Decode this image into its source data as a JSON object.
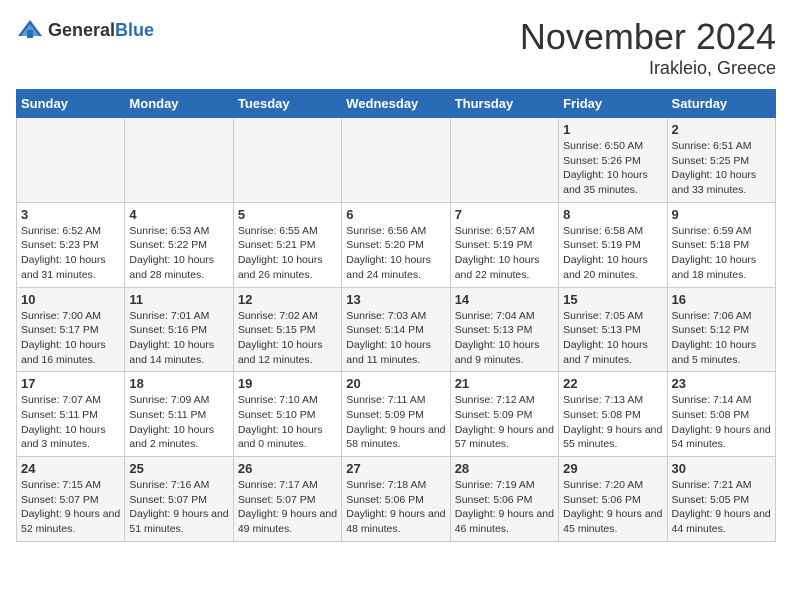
{
  "header": {
    "logo_general": "General",
    "logo_blue": "Blue",
    "month": "November 2024",
    "location": "Irakleio, Greece"
  },
  "calendar": {
    "days_of_week": [
      "Sunday",
      "Monday",
      "Tuesday",
      "Wednesday",
      "Thursday",
      "Friday",
      "Saturday"
    ],
    "weeks": [
      [
        {
          "day": "",
          "info": ""
        },
        {
          "day": "",
          "info": ""
        },
        {
          "day": "",
          "info": ""
        },
        {
          "day": "",
          "info": ""
        },
        {
          "day": "",
          "info": ""
        },
        {
          "day": "1",
          "info": "Sunrise: 6:50 AM\nSunset: 5:26 PM\nDaylight: 10 hours and 35 minutes."
        },
        {
          "day": "2",
          "info": "Sunrise: 6:51 AM\nSunset: 5:25 PM\nDaylight: 10 hours and 33 minutes."
        }
      ],
      [
        {
          "day": "3",
          "info": "Sunrise: 6:52 AM\nSunset: 5:23 PM\nDaylight: 10 hours and 31 minutes."
        },
        {
          "day": "4",
          "info": "Sunrise: 6:53 AM\nSunset: 5:22 PM\nDaylight: 10 hours and 28 minutes."
        },
        {
          "day": "5",
          "info": "Sunrise: 6:55 AM\nSunset: 5:21 PM\nDaylight: 10 hours and 26 minutes."
        },
        {
          "day": "6",
          "info": "Sunrise: 6:56 AM\nSunset: 5:20 PM\nDaylight: 10 hours and 24 minutes."
        },
        {
          "day": "7",
          "info": "Sunrise: 6:57 AM\nSunset: 5:19 PM\nDaylight: 10 hours and 22 minutes."
        },
        {
          "day": "8",
          "info": "Sunrise: 6:58 AM\nSunset: 5:19 PM\nDaylight: 10 hours and 20 minutes."
        },
        {
          "day": "9",
          "info": "Sunrise: 6:59 AM\nSunset: 5:18 PM\nDaylight: 10 hours and 18 minutes."
        }
      ],
      [
        {
          "day": "10",
          "info": "Sunrise: 7:00 AM\nSunset: 5:17 PM\nDaylight: 10 hours and 16 minutes."
        },
        {
          "day": "11",
          "info": "Sunrise: 7:01 AM\nSunset: 5:16 PM\nDaylight: 10 hours and 14 minutes."
        },
        {
          "day": "12",
          "info": "Sunrise: 7:02 AM\nSunset: 5:15 PM\nDaylight: 10 hours and 12 minutes."
        },
        {
          "day": "13",
          "info": "Sunrise: 7:03 AM\nSunset: 5:14 PM\nDaylight: 10 hours and 11 minutes."
        },
        {
          "day": "14",
          "info": "Sunrise: 7:04 AM\nSunset: 5:13 PM\nDaylight: 10 hours and 9 minutes."
        },
        {
          "day": "15",
          "info": "Sunrise: 7:05 AM\nSunset: 5:13 PM\nDaylight: 10 hours and 7 minutes."
        },
        {
          "day": "16",
          "info": "Sunrise: 7:06 AM\nSunset: 5:12 PM\nDaylight: 10 hours and 5 minutes."
        }
      ],
      [
        {
          "day": "17",
          "info": "Sunrise: 7:07 AM\nSunset: 5:11 PM\nDaylight: 10 hours and 3 minutes."
        },
        {
          "day": "18",
          "info": "Sunrise: 7:09 AM\nSunset: 5:11 PM\nDaylight: 10 hours and 2 minutes."
        },
        {
          "day": "19",
          "info": "Sunrise: 7:10 AM\nSunset: 5:10 PM\nDaylight: 10 hours and 0 minutes."
        },
        {
          "day": "20",
          "info": "Sunrise: 7:11 AM\nSunset: 5:09 PM\nDaylight: 9 hours and 58 minutes."
        },
        {
          "day": "21",
          "info": "Sunrise: 7:12 AM\nSunset: 5:09 PM\nDaylight: 9 hours and 57 minutes."
        },
        {
          "day": "22",
          "info": "Sunrise: 7:13 AM\nSunset: 5:08 PM\nDaylight: 9 hours and 55 minutes."
        },
        {
          "day": "23",
          "info": "Sunrise: 7:14 AM\nSunset: 5:08 PM\nDaylight: 9 hours and 54 minutes."
        }
      ],
      [
        {
          "day": "24",
          "info": "Sunrise: 7:15 AM\nSunset: 5:07 PM\nDaylight: 9 hours and 52 minutes."
        },
        {
          "day": "25",
          "info": "Sunrise: 7:16 AM\nSunset: 5:07 PM\nDaylight: 9 hours and 51 minutes."
        },
        {
          "day": "26",
          "info": "Sunrise: 7:17 AM\nSunset: 5:07 PM\nDaylight: 9 hours and 49 minutes."
        },
        {
          "day": "27",
          "info": "Sunrise: 7:18 AM\nSunset: 5:06 PM\nDaylight: 9 hours and 48 minutes."
        },
        {
          "day": "28",
          "info": "Sunrise: 7:19 AM\nSunset: 5:06 PM\nDaylight: 9 hours and 46 minutes."
        },
        {
          "day": "29",
          "info": "Sunrise: 7:20 AM\nSunset: 5:06 PM\nDaylight: 9 hours and 45 minutes."
        },
        {
          "day": "30",
          "info": "Sunrise: 7:21 AM\nSunset: 5:05 PM\nDaylight: 9 hours and 44 minutes."
        }
      ]
    ]
  }
}
